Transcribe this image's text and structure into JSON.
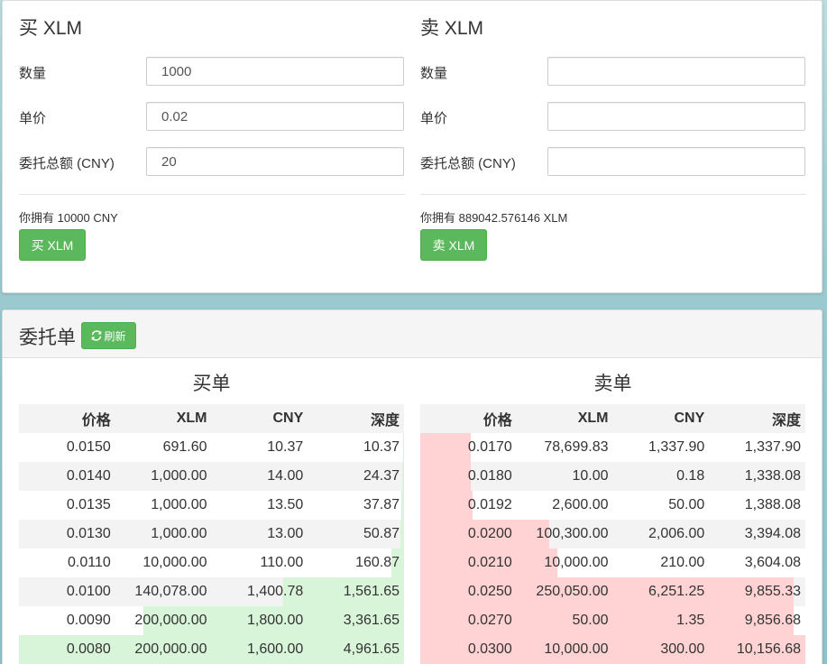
{
  "buy_form": {
    "title": "买 XLM",
    "quantity_label": "数量",
    "quantity_value": "1000",
    "price_label": "单价",
    "price_value": "0.02",
    "total_label": "委托总额 (CNY)",
    "total_value": "20",
    "balance": "你拥有 10000 CNY",
    "button_label": "买 XLM"
  },
  "sell_form": {
    "title": "卖 XLM",
    "quantity_label": "数量",
    "quantity_value": "",
    "price_label": "单价",
    "price_value": "",
    "total_label": "委托总额 (CNY)",
    "total_value": "",
    "balance": "你拥有 889042.576146 XLM",
    "button_label": "卖 XLM"
  },
  "orders": {
    "title": "委托单",
    "refresh_label": "刷新",
    "refresh_icon": "refresh-icon",
    "columns": [
      "价格",
      "XLM",
      "CNY",
      "深度"
    ],
    "buy": {
      "title": "买单",
      "bar_color": "#d9f5d9",
      "rows": [
        {
          "price": "0.0150",
          "xlm": "691.60",
          "cny": "10.37",
          "depth": "10.37"
        },
        {
          "price": "0.0140",
          "xlm": "1,000.00",
          "cny": "14.00",
          "depth": "24.37"
        },
        {
          "price": "0.0135",
          "xlm": "1,000.00",
          "cny": "13.50",
          "depth": "37.87"
        },
        {
          "price": "0.0130",
          "xlm": "1,000.00",
          "cny": "13.00",
          "depth": "50.87"
        },
        {
          "price": "0.0110",
          "xlm": "10,000.00",
          "cny": "110.00",
          "depth": "160.87"
        },
        {
          "price": "0.0100",
          "xlm": "140,078.00",
          "cny": "1,400.78",
          "depth": "1,561.65"
        },
        {
          "price": "0.0090",
          "xlm": "200,000.00",
          "cny": "1,800.00",
          "depth": "3,361.65"
        },
        {
          "price": "0.0080",
          "xlm": "200,000.00",
          "cny": "1,600.00",
          "depth": "4,961.65"
        }
      ]
    },
    "sell": {
      "title": "卖单",
      "bar_color": "#ffd3d3",
      "rows": [
        {
          "price": "0.0170",
          "xlm": "78,699.83",
          "cny": "1,337.90",
          "depth": "1,337.90"
        },
        {
          "price": "0.0180",
          "xlm": "10.00",
          "cny": "0.18",
          "depth": "1,338.08"
        },
        {
          "price": "0.0192",
          "xlm": "2,600.00",
          "cny": "50.00",
          "depth": "1,388.08"
        },
        {
          "price": "0.0200",
          "xlm": "100,300.00",
          "cny": "2,006.00",
          "depth": "3,394.08"
        },
        {
          "price": "0.0210",
          "xlm": "10,000.00",
          "cny": "210.00",
          "depth": "3,604.08"
        },
        {
          "price": "0.0250",
          "xlm": "250,050.00",
          "cny": "6,251.25",
          "depth": "9,855.33"
        },
        {
          "price": "0.0270",
          "xlm": "50.00",
          "cny": "1.35",
          "depth": "9,856.68"
        },
        {
          "price": "0.0300",
          "xlm": "10,000.00",
          "cny": "300.00",
          "depth": "10,156.68"
        }
      ]
    }
  }
}
